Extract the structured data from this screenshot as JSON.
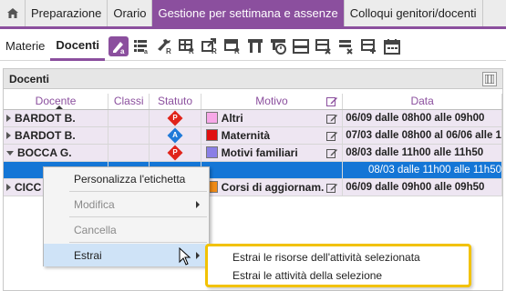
{
  "colors": {
    "accent": "#8b4f9e",
    "selection": "#1476d6",
    "row_bg": "#eee6f2",
    "highlight": "#f2c200"
  },
  "topbar": {
    "home_icon": "home-icon",
    "tabs": [
      {
        "label": "Preparazione"
      },
      {
        "label": "Orario"
      },
      {
        "label": "Gestione per settimana e assenze"
      },
      {
        "label": "Colloqui genitori/docenti"
      }
    ]
  },
  "subbar": {
    "tabs": [
      {
        "label": "Materie"
      },
      {
        "label": "Docenti"
      }
    ],
    "tools": [
      "edit-label-icon",
      "list-icon",
      "wrench-r-icon",
      "grid-r-icon",
      "export-r-icon",
      "table-r-icon",
      "column-filter-icon",
      "timer-icon",
      "split-row-icon",
      "grid-delete-icon",
      "table-x-icon",
      "table-plus-icon",
      "calendar-icon"
    ]
  },
  "panel": {
    "title": "Docenti",
    "columns": [
      "Docente",
      "Classi",
      "Statuto",
      "Motivo",
      "Data"
    ],
    "rows": [
      {
        "docente": "BARDOT B.",
        "classi": "",
        "statuto_letter": "P",
        "statuto_color": "#e0241b",
        "motivo": "Altri",
        "motivo_color": "#f7a8e8",
        "data": "06/09 dalle 08h00 alle 09h00",
        "expand": "right"
      },
      {
        "docente": "BARDOT B.",
        "classi": "",
        "statuto_letter": "A",
        "statuto_color": "#1f7ad8",
        "motivo": "Maternità",
        "motivo_color": "#e01010",
        "data": "07/03 dalle 08h00 al 06/06 alle 1",
        "expand": "right"
      },
      {
        "docente": "BOCCA G.",
        "classi": "",
        "statuto_letter": "P",
        "statuto_color": "#e0241b",
        "motivo": "Motivi familiari",
        "motivo_color": "#8a7fe6",
        "data": "08/03 dalle 11h00 alle 11h50",
        "expand": "down"
      },
      {
        "docente": "",
        "classi": "",
        "statuto_letter": "",
        "statuto_color": "",
        "motivo": "",
        "motivo_color": "",
        "data": "08/03 dalle 11h00 alle 11h50",
        "expand": "",
        "selected": true
      },
      {
        "docente": "CICC",
        "classi": "",
        "statuto_letter": "P",
        "statuto_color": "#e0241b",
        "motivo": "Corsi di aggiornam.",
        "motivo_color": "#f08a17",
        "data": "06/09 dalle 09h00 alle 09h50",
        "expand": "right"
      }
    ]
  },
  "context_menu": {
    "items": [
      {
        "label": "Personalizza l'etichetta"
      },
      {
        "label": "Modifica"
      },
      {
        "label": "Cancella"
      },
      {
        "label": "Estrai"
      }
    ]
  },
  "submenu": {
    "items": [
      {
        "label": "Estrai le risorse dell'attività selezionata"
      },
      {
        "label": "Estrai le attività della selezione"
      }
    ]
  }
}
